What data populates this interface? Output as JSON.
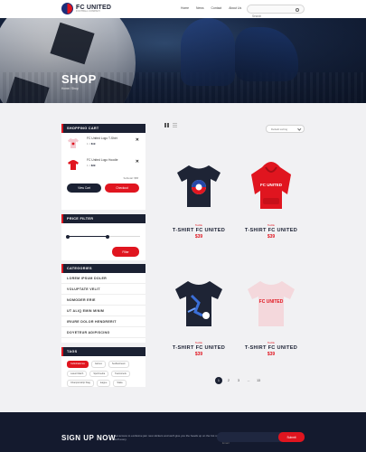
{
  "header": {
    "logo_title": "FC UNITED",
    "logo_subtitle": "FOOTBALL COMPANY",
    "nav": [
      "Home",
      "News",
      "Contact",
      "About Us"
    ],
    "search_placeholder": "Search"
  },
  "hero": {
    "title": "SHOP",
    "breadcrumb": "Home / Shop"
  },
  "sidebar": {
    "cart": {
      "heading": "SHOPPING CART",
      "items": [
        {
          "name": "FC United Logo T-Shirt",
          "qty": "1 ×",
          "price": "$19"
        },
        {
          "name": "FC United Logo Hoodie",
          "qty": "1 ×",
          "price": "$39"
        }
      ],
      "subtotal": "Subtotal: $58",
      "view_cart": "View Cart",
      "checkout": "Checkout"
    },
    "price_filter": {
      "heading": "PRICE FILTER",
      "range_low": 0,
      "range_high": 0.55,
      "button": "Filter"
    },
    "categories": {
      "heading": "CATEGORIES",
      "items": [
        "LOREM IPSUM DOLER",
        "VOLUPTATE VELIT",
        "NOMODER ERIE",
        "UT ALIQ EMIN MINIM",
        "IRIURE DOLOR HENDRERIT",
        "DOYETEUR ADIPISCING"
      ]
    },
    "tags": {
      "heading": "TAGS",
      "items": [
        "Cellebrationss",
        "Games",
        "Sedbestream",
        "Latest Match",
        "Sportmedia",
        "Teamsirenk",
        "Championship Stag",
        "league",
        "Stake"
      ]
    }
  },
  "main": {
    "sort_label": "Default sorting",
    "products": [
      {
        "category": "Textile",
        "name": "T-SHIRT FC UNITED",
        "price": "$39",
        "kind": "tee-logo"
      },
      {
        "category": "Textile",
        "name": "T-SHIRT FC UNITED",
        "price": "$39",
        "kind": "hoodie-red"
      },
      {
        "category": "Textile",
        "name": "T-SHIRT FC UNITED",
        "price": "$39",
        "kind": "tee-player"
      },
      {
        "category": "Textile",
        "name": "T-SHIRT FC UNITED",
        "price": "$39",
        "kind": "tee-pink"
      }
    ],
    "pagination": [
      "1",
      "2",
      "3",
      "...",
      "13"
    ]
  },
  "footer": {
    "title": "SIGN UP NOW",
    "text": "Get access to exclusive jam new stickers and we'll give you the heads up on the hot new stuff every.",
    "email_placeholder": "Email",
    "button": "Submit"
  },
  "colors": {
    "accent": "#e0151f",
    "navy": "#1b2133"
  }
}
